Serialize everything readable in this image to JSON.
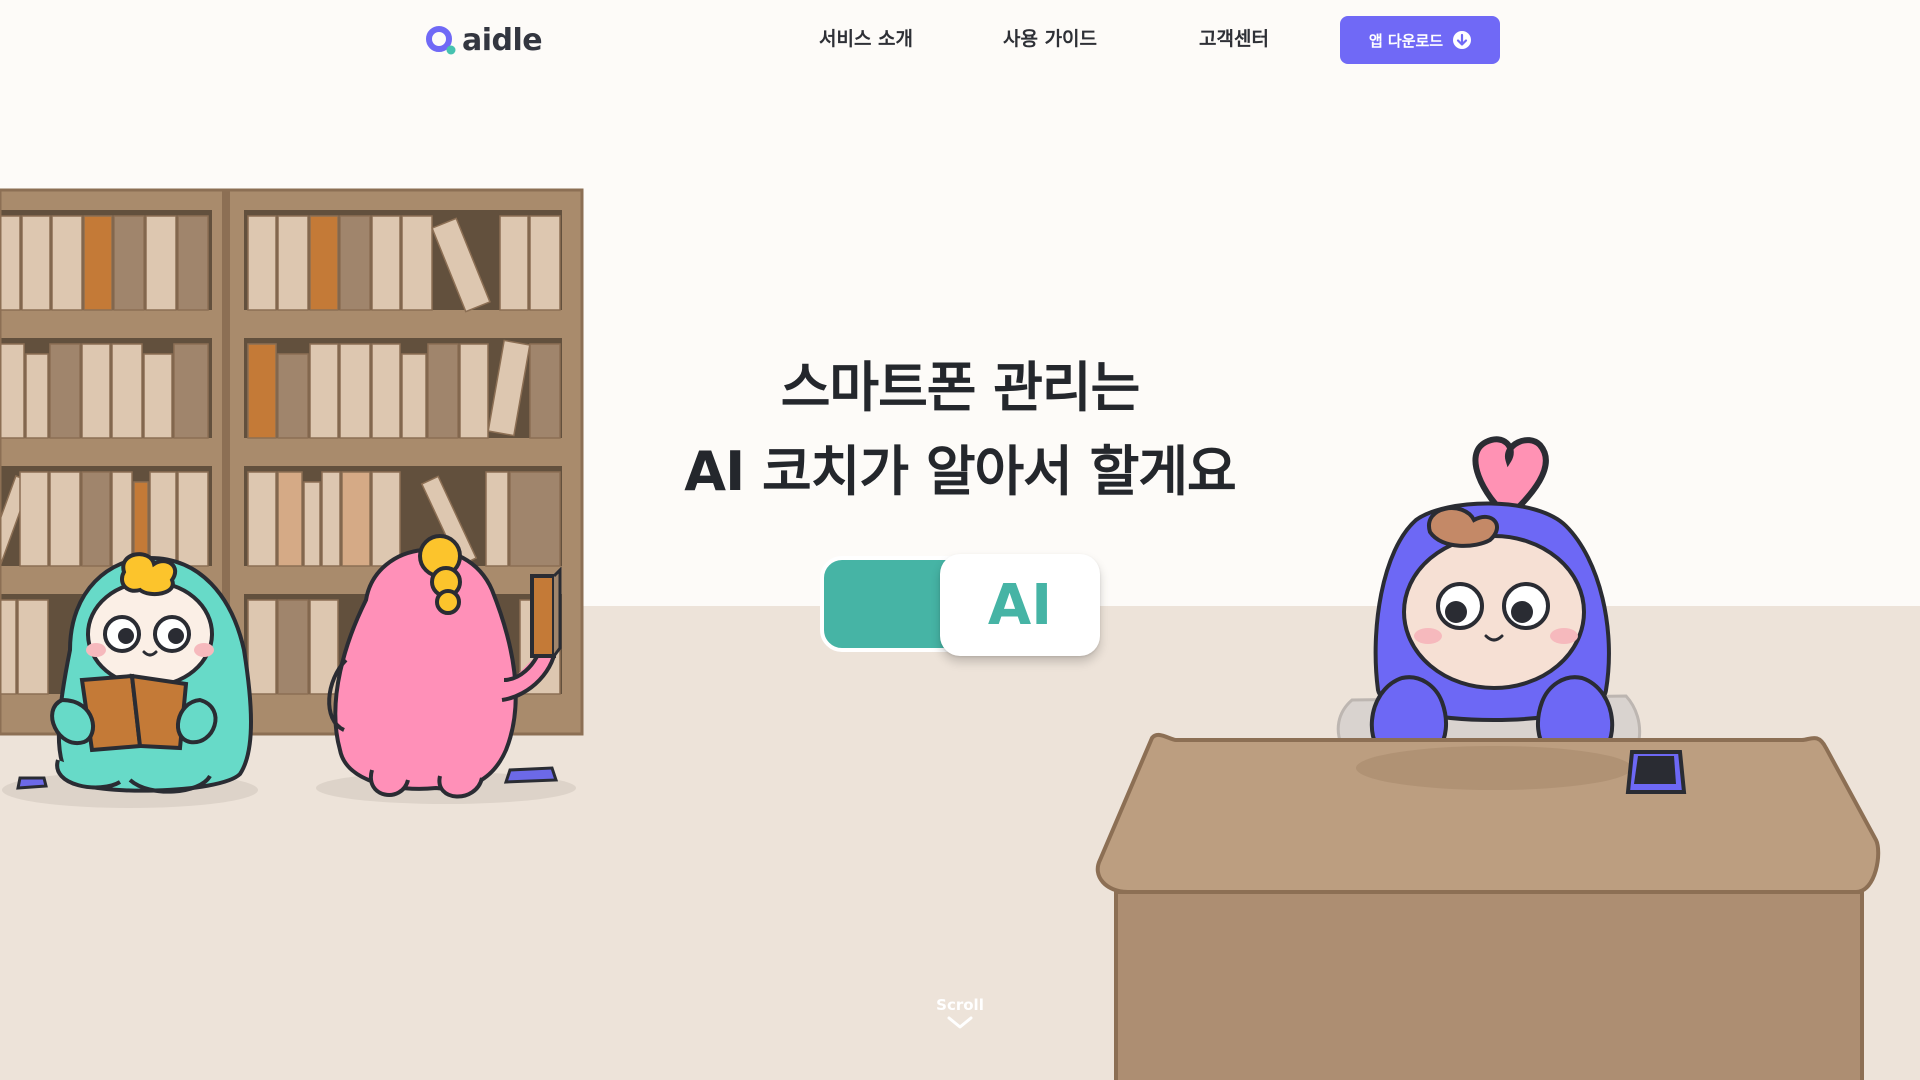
{
  "brand": {
    "name": "aidle",
    "primary": "#7069f6",
    "accent": "#46b4a5"
  },
  "nav": {
    "items": [
      {
        "label": "서비스 소개"
      },
      {
        "label": "사용 가이드"
      },
      {
        "label": "고객센터"
      }
    ],
    "download_label": "앱 다운로드",
    "download_icon": "arrow-down-circle-icon"
  },
  "hero": {
    "title_line1": "스마트폰 관리는",
    "title_line2": "AI 코치가 알아서 할게요",
    "toggle_label": "AI"
  },
  "scroll": {
    "label": "Scroll",
    "icon": "chevron-down-icon"
  }
}
